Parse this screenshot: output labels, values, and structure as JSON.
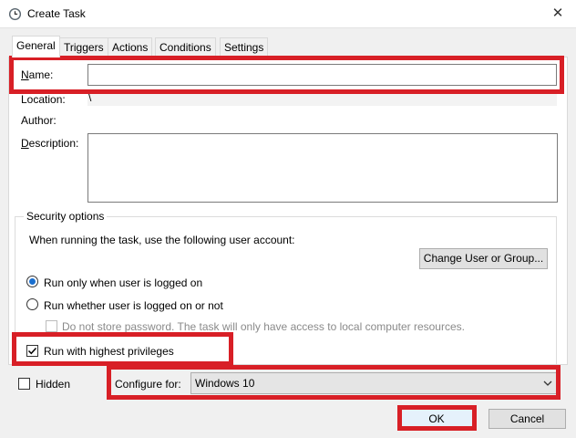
{
  "window": {
    "title": "Create Task",
    "close_glyph": "✕"
  },
  "tabs": [
    {
      "label": "General",
      "active": true
    },
    {
      "label": "Triggers"
    },
    {
      "label": "Actions"
    },
    {
      "label": "Conditions"
    },
    {
      "label": "Settings"
    }
  ],
  "general": {
    "name_label": "Name:",
    "name_value": "",
    "location_label": "Location:",
    "location_value": "\\",
    "author_label": "Author:",
    "author_value": "",
    "description_label": "Description:",
    "description_value": ""
  },
  "security": {
    "group_title": "Security options",
    "account_prompt": "When running the task, use the following user account:",
    "account_value": "",
    "change_user_button": "Change User or Group...",
    "radio_logged_on": "Run only when user is logged on",
    "radio_logged_on_selected": true,
    "radio_whether": "Run whether user is logged on or not",
    "radio_whether_selected": false,
    "no_store_password": "Do not store password.  The task will only have access to local computer resources.",
    "no_store_password_checked": false,
    "highest_privileges": "Run with highest privileges",
    "highest_privileges_checked": true
  },
  "bottom": {
    "hidden_label": "Hidden",
    "hidden_checked": false,
    "configure_label": "Configure for:",
    "configure_value": "Windows 10",
    "ok_button": "OK",
    "cancel_button": "Cancel"
  },
  "colors": {
    "highlight": "#d81f26",
    "radio_accent": "#1a6fcf"
  },
  "icons": {
    "title": "clock-icon",
    "close": "close-icon",
    "dropdown": "chevron-down-icon"
  }
}
